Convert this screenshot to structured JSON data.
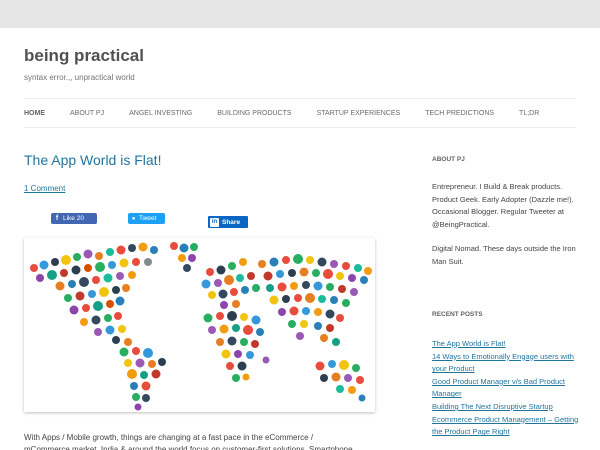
{
  "site": {
    "title": "being practical",
    "description": "syntax error.,, unpractical world"
  },
  "nav": {
    "items": [
      {
        "label": "HOME",
        "active": true
      },
      {
        "label": "ABOUT PJ"
      },
      {
        "label": "ANGEL INVESTING"
      },
      {
        "label": "BUILDING PRODUCTS"
      },
      {
        "label": "STARTUP EXPERIENCES"
      },
      {
        "label": "TECH PREDICTIONS"
      },
      {
        "label": "TL;DR"
      }
    ]
  },
  "post": {
    "title": "The App World is Flat!",
    "comments_link": "1 Comment",
    "share": {
      "fb_like": "Like 20",
      "tweet": "Tweet",
      "linkedin_share": "Share"
    },
    "excerpt": "With Apps / Mobile growth, things are changing at a fast pace in the eCommerce / mCommerce market. India & around the world focus on customer-first solutions. Smartphone"
  },
  "sidebar": {
    "about": {
      "title": "ABOUT PJ",
      "p1": "Entrepreneur. I Build & Break products. Product Geek. Early Adopter (Dazzle me!). Occasional Blogger. Regular Tweeter at @BeingPractical.",
      "p2": "Digital Nomad. These days outside the Iron Man Suit."
    },
    "recent": {
      "title": "RECENT POSTS",
      "items": [
        "The App World is Flat!",
        "14 Ways to Emotionally Engage users with your Product",
        "Good Product Manager v/s Bad Product Manager",
        "Building The Next Disruptive Startup",
        "Ecommerce Product Management – Getting the Product Page Right"
      ]
    }
  },
  "colors": {
    "link": "#21759b",
    "background": "#e6e6e6",
    "facebook": "#4267b2",
    "twitter": "#1da1f2",
    "linkedin": "#0a66c2"
  }
}
